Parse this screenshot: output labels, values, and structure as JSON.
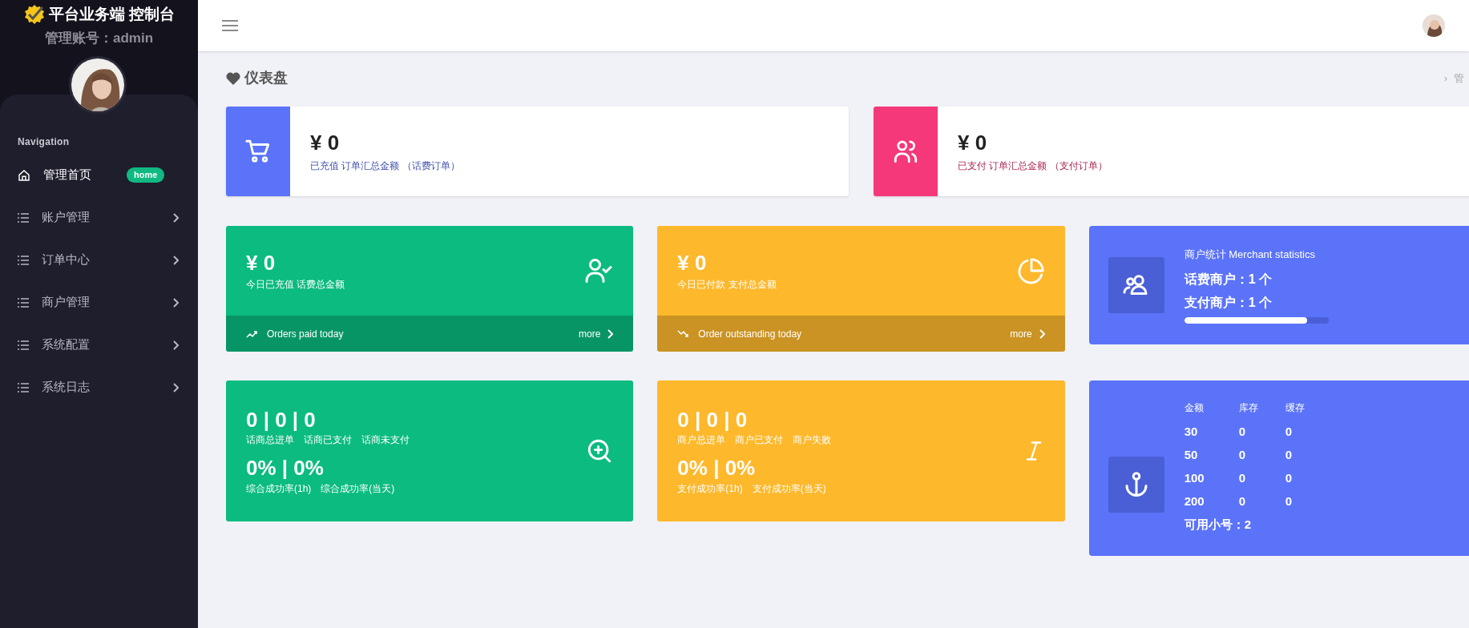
{
  "sidebar": {
    "brand": "平台业务端 控制台",
    "account": "管理账号：admin",
    "nav_heading": "Navigation",
    "items": [
      {
        "kind": "home",
        "label": "管理首页",
        "badge": "home",
        "selected": true
      },
      {
        "kind": "group",
        "label": "账户管理",
        "selected": false
      },
      {
        "kind": "group",
        "label": "订单中心",
        "selected": false
      },
      {
        "kind": "group",
        "label": "商户管理",
        "selected": false
      },
      {
        "kind": "group",
        "label": "系统配置",
        "selected": false
      },
      {
        "kind": "group",
        "label": "系统日志",
        "selected": false
      }
    ]
  },
  "page": {
    "title": "仪表盘",
    "breadcrumb": [
      "›",
      "管"
    ]
  },
  "summary_cards": [
    {
      "kind": "cart",
      "color": "#5b73f8",
      "amount": "¥ 0",
      "caption": "已充值 订单汇总金额 （话费订单）"
    },
    {
      "kind": "users",
      "color": "#f5387a",
      "amount": "¥ 0",
      "caption": "已支付 订单汇总金额 （支付订单）"
    }
  ],
  "stat_cards": [
    {
      "kind": "user-check",
      "color": "#0bbb80",
      "amount": "¥ 0",
      "caption": "今日已充值 话费总金额",
      "footer": "Orders paid today",
      "more": "more"
    },
    {
      "kind": "pie",
      "color": "#fdb82c",
      "amount": "¥ 0",
      "caption": "今日已付款 支付总金额",
      "footer": "Order outstanding today",
      "more": "more"
    }
  ],
  "merchant_card": {
    "title": "商户统计 Merchant statistics",
    "lines": [
      "话费商户：1 个",
      "支付商户：1 个"
    ],
    "level": 0.85
  },
  "count_cards": [
    {
      "kind": "zoom",
      "color": "#0bbb80",
      "counts": "0 | 0 | 0",
      "count_labels": [
        "话商总进单",
        "话商已支付",
        "话商未支付"
      ],
      "rates": "0% | 0%",
      "rate_labels": [
        "综合成功率(1h)",
        "综合成功率(当天)"
      ]
    },
    {
      "kind": "italic",
      "color": "#fdb82c",
      "counts": "0 | 0 | 0",
      "count_labels": [
        "商户总进单",
        "商户已支付",
        "商户失败"
      ],
      "rates": "0% | 0%",
      "rate_labels": [
        "支付成功率(1h)",
        "支付成功率(当天)"
      ]
    }
  ],
  "stock_card": {
    "columns": [
      "金额",
      "库存",
      "缓存"
    ],
    "rows": [
      [
        "30",
        "0",
        "0"
      ],
      [
        "50",
        "0",
        "0"
      ],
      [
        "100",
        "0",
        "0"
      ],
      [
        "200",
        "0",
        "0"
      ]
    ],
    "footer": "可用小号：2"
  }
}
